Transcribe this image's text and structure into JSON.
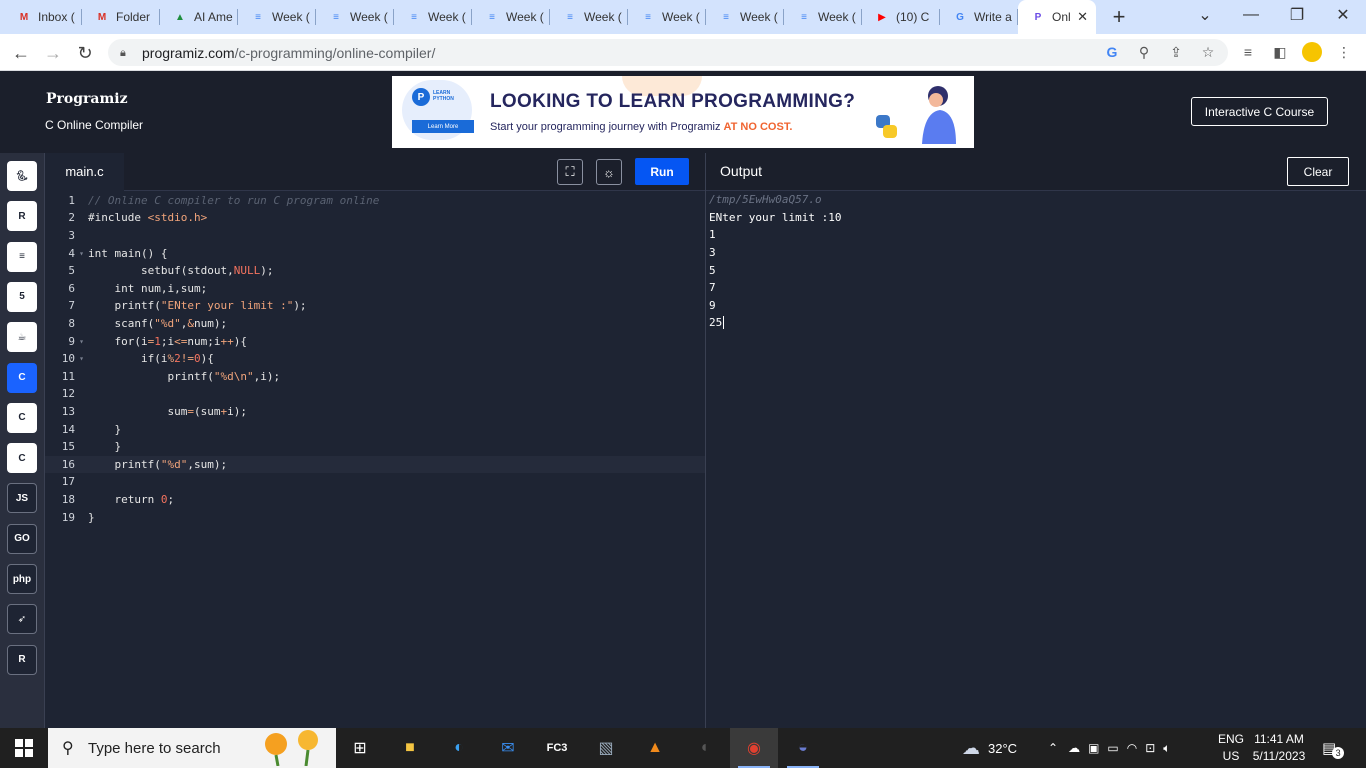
{
  "browser": {
    "tabs": [
      {
        "title": "Inbox (",
        "icon": "gmail-icon"
      },
      {
        "title": "Folder",
        "icon": "gmail-icon"
      },
      {
        "title": "AI Ame",
        "icon": "drive-icon"
      },
      {
        "title": "Week (",
        "icon": "docs-icon"
      },
      {
        "title": "Week (",
        "icon": "docs-icon"
      },
      {
        "title": "Week (",
        "icon": "docs-icon"
      },
      {
        "title": "Week (",
        "icon": "docs-icon"
      },
      {
        "title": "Week (",
        "icon": "docs-icon"
      },
      {
        "title": "Week (",
        "icon": "docs-icon"
      },
      {
        "title": "Week (",
        "icon": "docs-icon"
      },
      {
        "title": "Week (",
        "icon": "docs-icon"
      },
      {
        "title": "(10) C",
        "icon": "youtube-icon"
      },
      {
        "title": "Write a",
        "icon": "google-icon"
      },
      {
        "title": "Onl",
        "icon": "programiz-icon",
        "active": true
      }
    ],
    "url_host": "programiz.com",
    "url_path": "/c-programming/online-compiler/"
  },
  "header": {
    "logo": "Programiz",
    "subtitle": "C Online Compiler",
    "banner": {
      "mini_logo_text": "LEARN PYTHON",
      "learn_more": "Learn More",
      "headline": "LOOKING TO LEARN PROGRAMMING?",
      "tagline_prefix": "Start your programming journey with Programiz ",
      "tagline_highlight": "AT NO COST."
    },
    "course_button": "Interactive C Course"
  },
  "sidebar": {
    "languages": [
      {
        "name": "python",
        "label": ""
      },
      {
        "name": "r",
        "label": "R"
      },
      {
        "name": "sql",
        "label": ""
      },
      {
        "name": "html",
        "label": "5"
      },
      {
        "name": "java",
        "label": ""
      },
      {
        "name": "c",
        "label": "C",
        "active": true
      },
      {
        "name": "cpp",
        "label": "C"
      },
      {
        "name": "csharp",
        "label": "C"
      },
      {
        "name": "js",
        "label": "JS"
      },
      {
        "name": "go",
        "label": "GO"
      },
      {
        "name": "php",
        "label": "php"
      },
      {
        "name": "swift",
        "label": ""
      },
      {
        "name": "rust",
        "label": "R"
      }
    ]
  },
  "editor": {
    "filename": "main.c",
    "run_label": "Run",
    "current_line": 16,
    "lines": [
      "// Online C compiler to run C program online",
      "#include <stdio.h>",
      "",
      "int main() {",
      "        setbuf(stdout,NULL);",
      "    int num,i,sum;",
      "    printf(\"ENter your limit :\");",
      "    scanf(\"%d\",&num);",
      "    for(i=1;i<=num;i++){",
      "        if(i%2!=0){",
      "            printf(\"%d\\n\",i);",
      "",
      "            sum=(sum+i);",
      "    }",
      "    }",
      "    printf(\"%d\",sum);",
      "",
      "    return 0;",
      "}"
    ]
  },
  "output": {
    "title": "Output",
    "clear_label": "Clear",
    "path": "/tmp/5EwHw0aQ57.o",
    "lines": [
      "ENter your limit :10",
      "1",
      "3",
      "5",
      "7",
      "9",
      "25"
    ]
  },
  "taskbar": {
    "search_placeholder": "Type here to search",
    "weather": "32°C",
    "lang_top": "ENG",
    "lang_bottom": "US",
    "time": "11:41 AM",
    "date": "5/11/2023",
    "notifications": "3"
  }
}
